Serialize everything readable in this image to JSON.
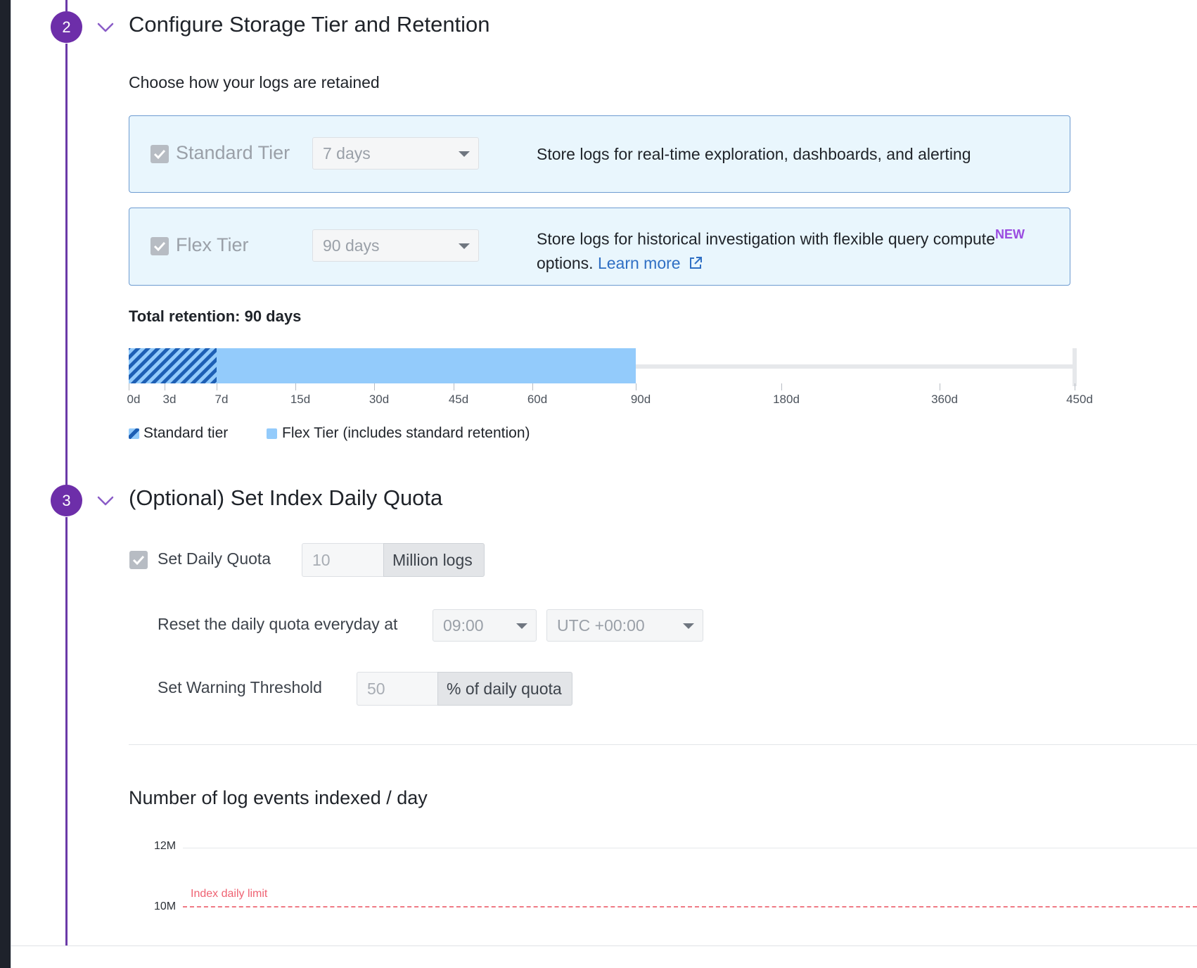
{
  "step2": {
    "number": "2",
    "title": "Configure Storage Tier and Retention",
    "subtitle": "Choose how your logs are retained",
    "standard_tier": {
      "label": "Standard Tier",
      "checked": true,
      "retention": "7 days",
      "description": "Store logs for real-time exploration, dashboards, and alerting"
    },
    "flex_tier": {
      "label": "Flex Tier",
      "checked": true,
      "retention": "90 days",
      "description": "Store logs for historical investigation with flexible query compute",
      "badge": "NEW",
      "description_cont": "options.",
      "link": "Learn more"
    },
    "total_retention": "Total retention: 90 days",
    "retention_bar": {
      "standard_days": 7,
      "flex_days": 90,
      "max_days": 450,
      "ticks": [
        "0d",
        "3d",
        "7d",
        "15d",
        "30d",
        "45d",
        "60d",
        "90d",
        "180d",
        "360d",
        "450d"
      ]
    },
    "legend": {
      "standard": "Standard tier",
      "flex": "Flex Tier (includes standard retention)"
    }
  },
  "step3": {
    "number": "3",
    "title": "(Optional) Set Index Daily Quota",
    "daily_quota": {
      "label": "Set Daily Quota",
      "checked": true,
      "value": "10",
      "unit": "Million logs"
    },
    "reset": {
      "label": "Reset the daily quota everyday at",
      "time": "09:00",
      "timezone": "UTC +00:00"
    },
    "warning": {
      "label": "Set Warning Threshold",
      "value": "50",
      "unit": "% of daily quota"
    }
  },
  "chart": {
    "title": "Number of log events indexed / day",
    "y_ticks": [
      "12M",
      "10M"
    ],
    "limit_label": "Index daily limit"
  },
  "colors": {
    "step_purple": "#6d2ea9",
    "flex_blue": "#93cbfb",
    "standard_stripe": "#1d5fb5",
    "limit_red": "#ef7a85",
    "link_blue": "#2f6fc4",
    "new_badge": "#9a4ce0"
  },
  "chart_data": {
    "type": "line",
    "title": "Number of log events indexed / day",
    "y_ticks": [
      "12M",
      "10M"
    ],
    "ylabel": "",
    "xlabel": "",
    "series": [],
    "annotations": [
      {
        "label": "Index daily limit",
        "y": 10000000,
        "style": "dashed"
      }
    ]
  }
}
